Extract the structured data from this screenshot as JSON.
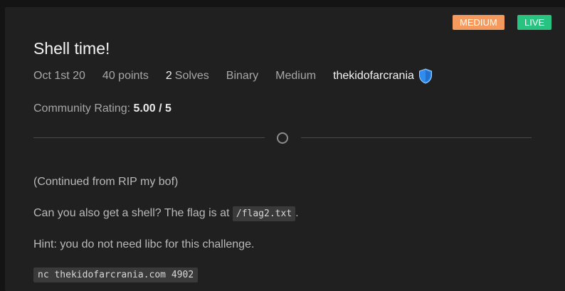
{
  "badges": {
    "difficulty": "MEDIUM",
    "status": "LIVE"
  },
  "challenge": {
    "title": "Shell time!",
    "date": "Oct 1st 20",
    "points": "40 points",
    "solves_count": "2",
    "solves_label": "Solves",
    "category": "Binary",
    "difficulty": "Medium",
    "author": "thekidofarcrania",
    "author_badge_icon": "shield-icon"
  },
  "rating": {
    "label": "Community Rating:",
    "value": "5.00 / 5"
  },
  "description": {
    "intro": "(Continued from RIP my bof)",
    "question_before": "Can you also get a shell? The flag is at ",
    "flag_path": "/flag2.txt",
    "question_after": ".",
    "hint": "Hint: you do not need libc for this challenge.",
    "command": "nc thekidofarcrania.com 4902"
  },
  "colors": {
    "background": "#141414",
    "card": "#202020",
    "medium_badge": "#f49a5f",
    "live_badge": "#28c281",
    "shield": "#2f8df0"
  }
}
